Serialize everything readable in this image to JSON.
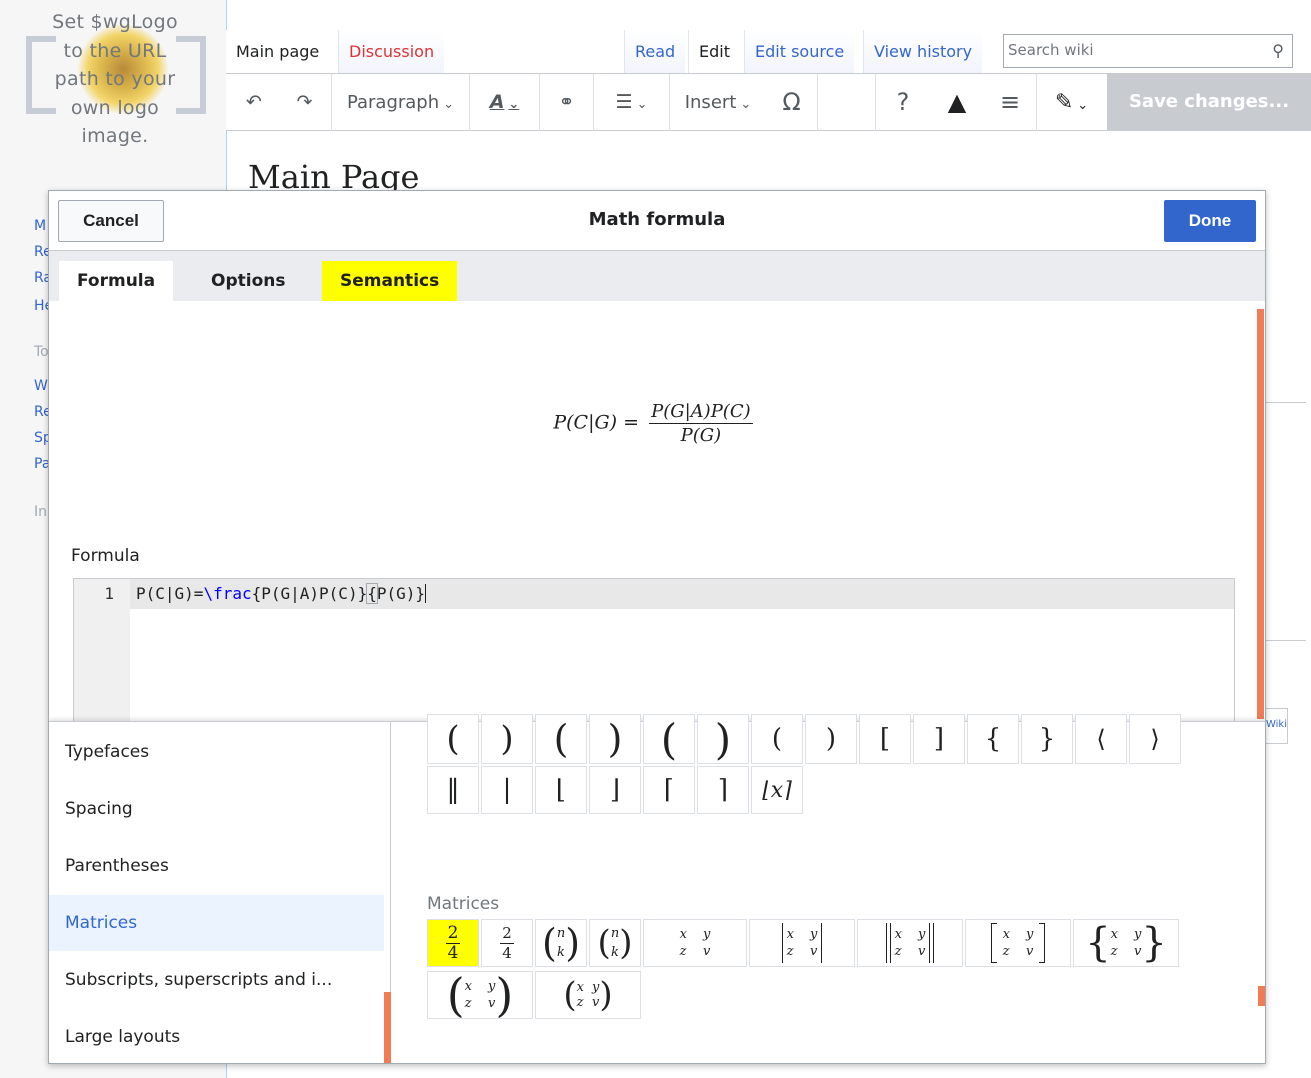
{
  "logo": {
    "text_lines": [
      "Set $wgLogo",
      "to the URL",
      "path to your",
      "own logo",
      "image."
    ]
  },
  "sidebar_letters": [
    "M",
    "Re",
    "Ra",
    "He",
    "To",
    "W",
    "Re",
    "Sp",
    "Pa",
    "In"
  ],
  "page_tabs": {
    "main_page": "Main page",
    "discussion": "Discussion",
    "read": "Read",
    "edit": "Edit",
    "edit_source": "Edit source",
    "view_history": "View history"
  },
  "search": {
    "placeholder": "Search wiki"
  },
  "toolbar": {
    "paragraph": "Paragraph",
    "insert": "Insert",
    "save": "Save changes..."
  },
  "page_heading": "Main Page",
  "powered_text": "Wiki",
  "dialog": {
    "cancel": "Cancel",
    "title": "Math formula",
    "done": "Done",
    "tabs": {
      "formula": "Formula",
      "options": "Options",
      "semantics": "Semantics"
    },
    "preview": {
      "lhs": "P(C|G) =",
      "numerator": "P(G|A)P(C)",
      "denominator": "P(G)"
    },
    "formula_label": "Formula",
    "code": {
      "line_number": "1",
      "pre": "P(C|G)=",
      "keyword": "\\frac",
      "arg1": "{P(G|A)P(C)}",
      "arg2_open": "{",
      "arg2_rest": "P(G)}"
    }
  },
  "palette": {
    "menu": [
      "Typefaces",
      "Spacing",
      "Parentheses",
      "Matrices",
      "Subscripts, superscripts and i...",
      "Large layouts"
    ],
    "selected_menu": "Matrices",
    "paren_row1": [
      "(",
      ")",
      "(",
      ")",
      "(",
      ")",
      "(",
      ")",
      "[",
      "]",
      "{",
      "}",
      "⟨",
      "⟩"
    ],
    "paren_row2": [
      "‖",
      "|",
      "⌊",
      "⌋",
      "⌈",
      "⌉",
      "⌊x⌉"
    ],
    "matrices_label": "Matrices",
    "matrix": {
      "x": "x",
      "y": "y",
      "z": "z",
      "v": "v",
      "n": "n",
      "k": "k",
      "two": "2",
      "four": "4"
    }
  },
  "colors": {
    "accent": "#3366cc",
    "highlight": "#ffff00",
    "scrollbar": "#f07b55"
  }
}
